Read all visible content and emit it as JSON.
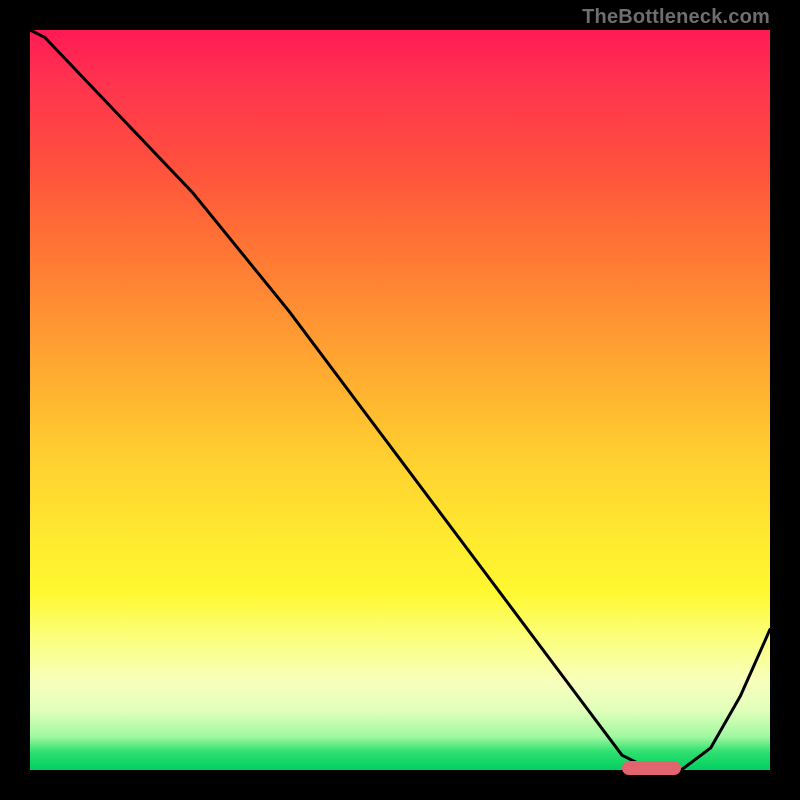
{
  "attribution": "TheBottleneck.com",
  "chart_data": {
    "type": "line",
    "title": "",
    "xlabel": "",
    "ylabel": "",
    "xlim": [
      0,
      100
    ],
    "ylim": [
      0,
      100
    ],
    "grid": false,
    "series": [
      {
        "name": "curve",
        "color": "#000000",
        "x": [
          0,
          2,
          22,
          35,
          50,
          65,
          74,
          80,
          84,
          88,
          92,
          96,
          100
        ],
        "y": [
          100,
          99,
          78,
          62,
          42,
          22,
          10,
          2,
          0,
          0,
          3,
          10,
          19
        ]
      }
    ],
    "optimal_marker": {
      "x_start": 80,
      "x_end": 88,
      "y": 0,
      "color": "#e2646f"
    },
    "gradient_stops": [
      {
        "pct": 0,
        "color": "#ff1a54"
      },
      {
        "pct": 50,
        "color": "#ffd030"
      },
      {
        "pct": 85,
        "color": "#fbff7a"
      },
      {
        "pct": 100,
        "color": "#00d060"
      }
    ]
  }
}
